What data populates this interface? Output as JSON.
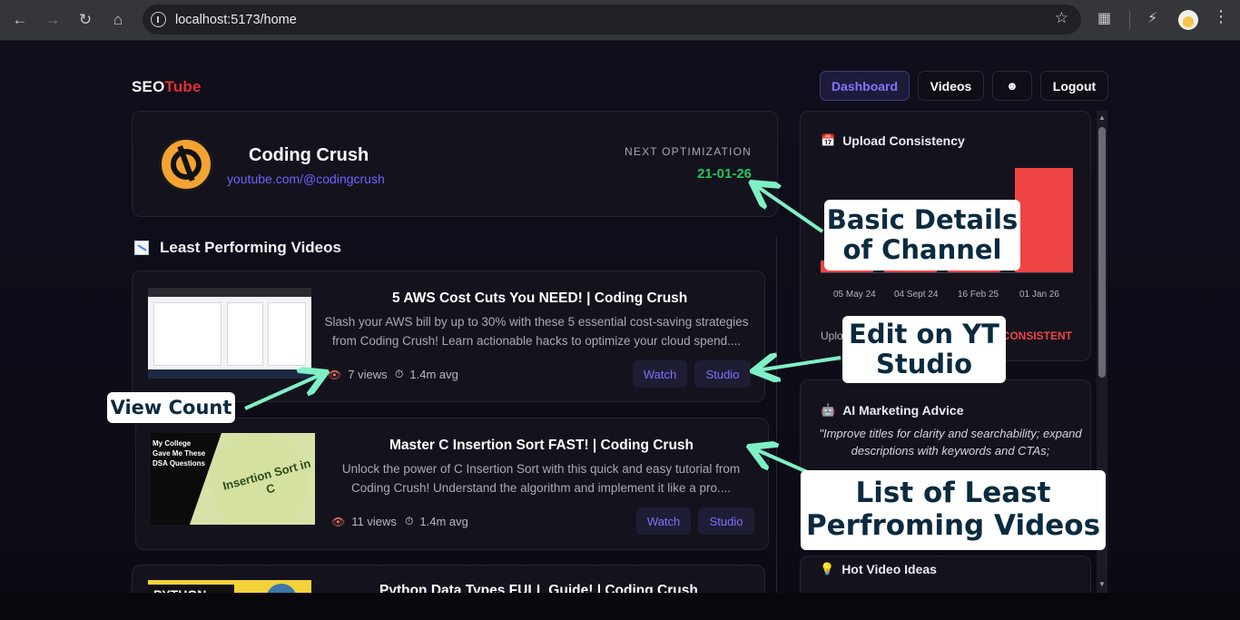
{
  "browser": {
    "url": "localhost:5173/home"
  },
  "app": {
    "logo_part1": "SEO",
    "logo_part2": "Tube",
    "nav": {
      "dashboard": "Dashboard",
      "videos": "Videos",
      "profile_icon": "user-icon",
      "logout": "Logout"
    }
  },
  "channel": {
    "name": "Coding Crush",
    "url": "youtube.com/@codingcrush",
    "next_optimization_label": "NEXT OPTIMIZATION",
    "next_optimization_date": "21-01-26"
  },
  "least_performing": {
    "title": "Least Performing Videos",
    "videos": [
      {
        "title": "5 AWS Cost Cuts You NEED! | Coding Crush",
        "description": "Slash your AWS bill by up to 30% with these 5 essential cost-saving strategies from Coding Crush! Learn actionable hacks to optimize your cloud spend....",
        "views": "7 views",
        "avg": "1.4m avg",
        "watch": "Watch",
        "studio": "Studio"
      },
      {
        "title": "Master C Insertion Sort FAST! | Coding Crush",
        "description": "Unlock the power of C Insertion Sort with this quick and easy tutorial from Coding Crush! Understand the algorithm and implement it like a pro....",
        "views": "11 views",
        "avg": "1.4m avg",
        "watch": "Watch",
        "studio": "Studio",
        "thumb_left_text": "My College Gave Me These DSA Questions",
        "thumb_circle_text": "Insertion Sort in C"
      },
      {
        "title": "Python Data Types FULL Guide! | Coding Crush",
        "thumb_text": "PYTHON"
      }
    ]
  },
  "sidebar": {
    "upload_consistency": {
      "title": "Upload Consistency",
      "x_labels": [
        "05 May 24",
        "04 Sept 24",
        "16 Feb 25",
        "01 Jan 26"
      ],
      "status_label": "Uplo",
      "status_value": "CONSISTENT",
      "bar_color": "#ef4444"
    },
    "ai_advice": {
      "title": "AI Marketing Advice",
      "text": "\"Improve titles for clarity and searchability; expand descriptions with keywords and CTAs;"
    },
    "hot_ideas": {
      "title": "Hot Video Ideas"
    }
  },
  "annotations": {
    "basic_details_line1": "Basic Details",
    "basic_details_line2": "of Channel",
    "edit_line1": "Edit on YT",
    "edit_line2": "Studio",
    "view_count": "View Count",
    "list_line1": "List of  Least",
    "list_line2": "Perfroming Videos",
    "arrow_color": "#7ff0c6"
  }
}
